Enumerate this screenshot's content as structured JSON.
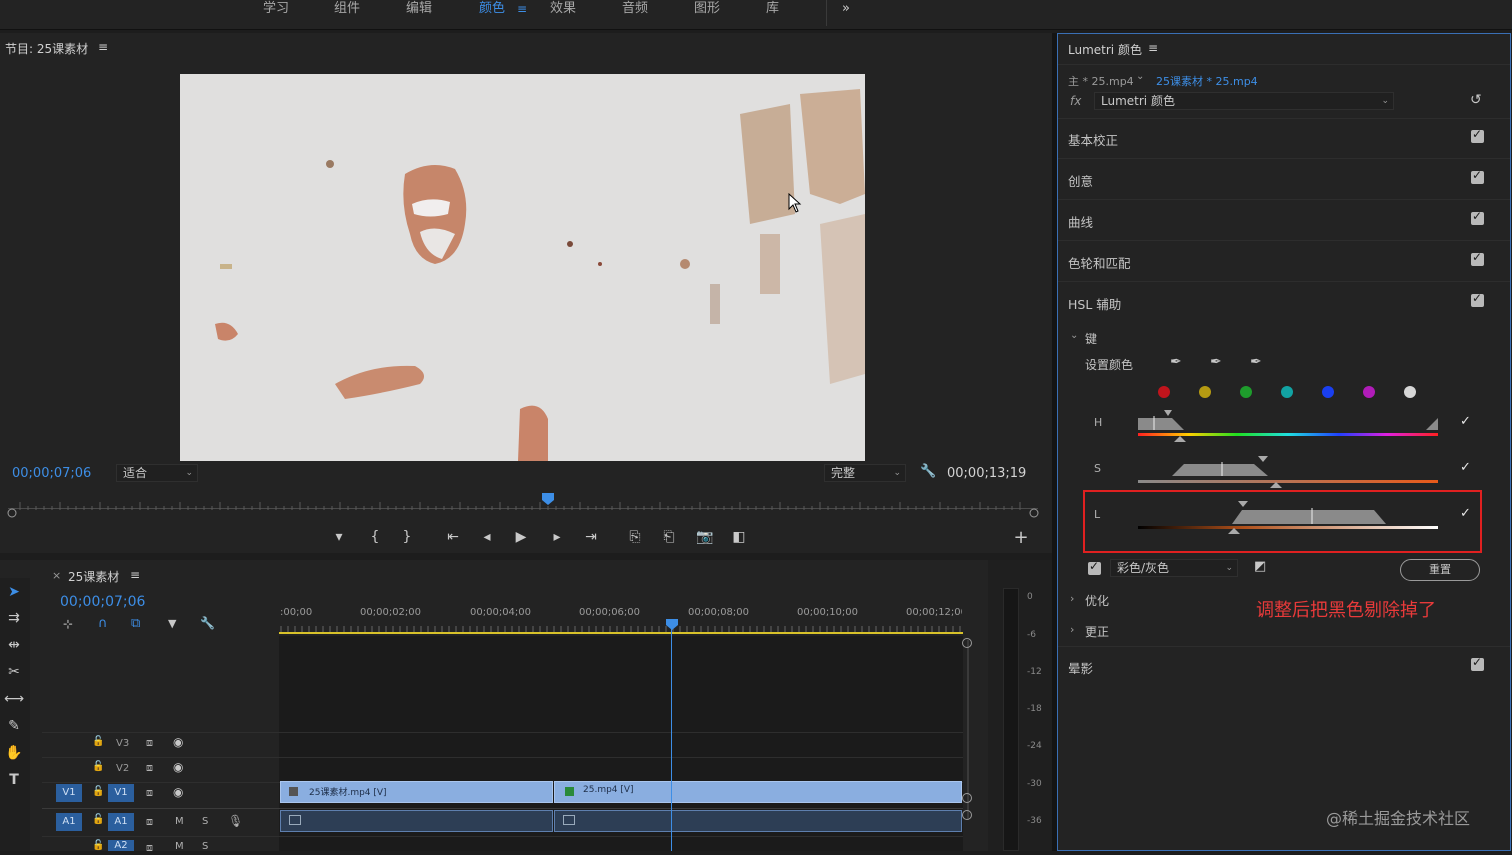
{
  "workspace_tabs": [
    "学习",
    "组件",
    "编辑",
    "颜色",
    "效果",
    "音频",
    "图形",
    "库"
  ],
  "workspace_active": "颜色",
  "more_label": "»",
  "program": {
    "title": "节目: 25课素材",
    "menu_icon": "≡",
    "timecode_current": "00;00;07;06",
    "fit_value": "适合",
    "quality_value": "完整",
    "timecode_duration": "00;00;13;19"
  },
  "transport": [
    "add-marker",
    "mark-in",
    "mark-out",
    "go-to-in",
    "step-back",
    "play",
    "step-forward",
    "go-to-out",
    "insert",
    "overwrite",
    "export-frame",
    "compare"
  ],
  "lumetri": {
    "title": "Lumetri 颜色",
    "source_label": "主 * 25.mp4",
    "sequence_label": "25课素材 * 25.mp4",
    "fx_label": "fx",
    "effect_select": "Lumetri 颜色",
    "sections": [
      "基本校正",
      "创意",
      "曲线",
      "色轮和匹配",
      "HSL 辅助"
    ],
    "key_label": "键",
    "set_color_label": "设置颜色",
    "swatch_colors": [
      "#c0141c",
      "#b59a12",
      "#1e9c2c",
      "#12a3a3",
      "#1a3ff0",
      "#b01cb8",
      "#d6d6d6"
    ],
    "hsl_rows": [
      "H",
      "S",
      "L"
    ],
    "mode_select": "彩色/灰色",
    "reset_label": "重置",
    "refine_label": "优化",
    "correct_label": "更正",
    "vignette_label": "晕影",
    "annotation": "调整后把黑色剔除掉了"
  },
  "timeline": {
    "sequence_name": "25课素材",
    "timecode": "00;00;07;06",
    "ruler": [
      ":00;00",
      "00;00;02;00",
      "00;00;04;00",
      "00;00;06;00",
      "00;00;08;00",
      "00;00;10;00",
      "00;00;12;00"
    ],
    "tracks": [
      "V3",
      "V2",
      "V1",
      "A1",
      "A2"
    ],
    "clip1_label": "25课素材.mp4 [V]",
    "clip2_label": "25.mp4 [V]",
    "meter_labels": [
      "0",
      "-6",
      "-12",
      "-18",
      "-24",
      "-30",
      "-36"
    ]
  },
  "watermark": "@稀土掘金技术社区"
}
